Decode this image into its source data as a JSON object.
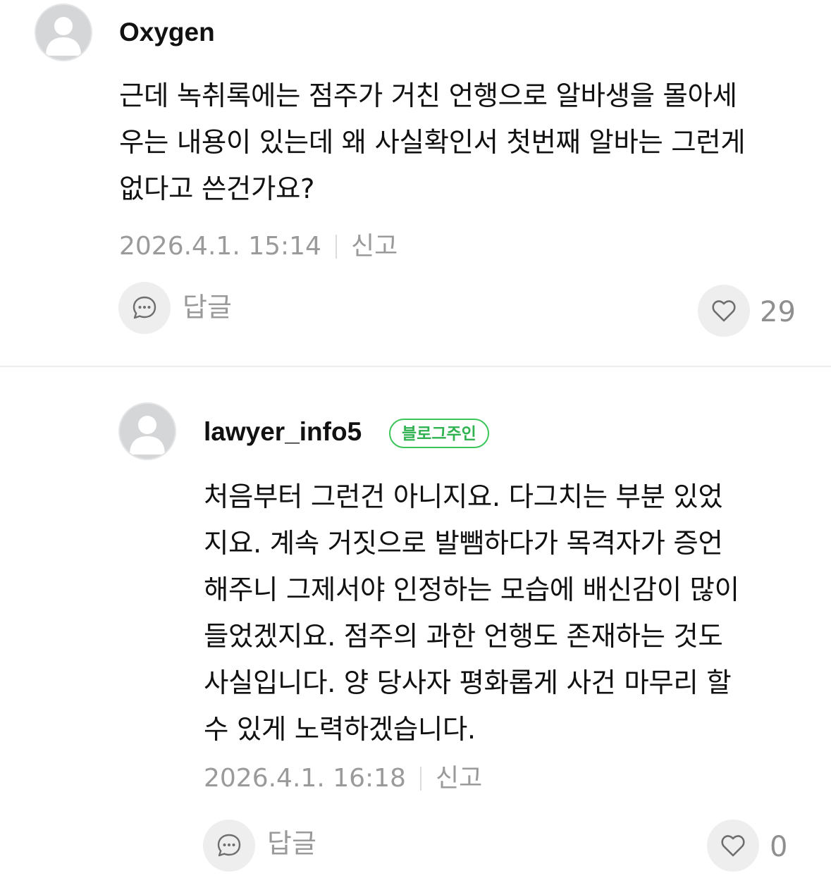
{
  "comments": [
    {
      "author": "Oxygen",
      "badge": "",
      "text": "근데 녹취록에는 점주가 거친 언행으로 알바생을 몰아세\n우는 내용이 있는데 왜 사실확인서 첫번째 알바는 그런게\n없다고 쓴건가요?",
      "timestamp": "2026.4.1. 15:14",
      "report_label": "신고",
      "reply_label": "답글",
      "like_count": "29",
      "avatar_icon": "user-silhouette-icon"
    },
    {
      "author": "lawyer_info5",
      "badge": "블로그주인",
      "text": "처음부터 그런건 아니지요. 다그치는 부분 있었\n지요. 계속 거짓으로 발뺌하다가 목격자가 증언\n해주니 그제서야 인정하는 모습에 배신감이 많이\n들었겠지요. 점주의 과한 언행도 존재하는 것도\n사실입니다. 양 당사자 평화롭게 사건 마무리 할\n수 있게 노력하겠습니다.",
      "timestamp": "2026.4.1. 16:18",
      "report_label": "신고",
      "reply_label": "답글",
      "like_count": "0",
      "avatar_icon": "user-silhouette-icon"
    }
  ],
  "colors": {
    "badge_green": "#2fb24f",
    "meta_gray": "#9a9a9a",
    "button_bg": "#eeeeee"
  },
  "icons": {
    "reply": "speech-bubble-icon",
    "like": "heart-icon"
  }
}
